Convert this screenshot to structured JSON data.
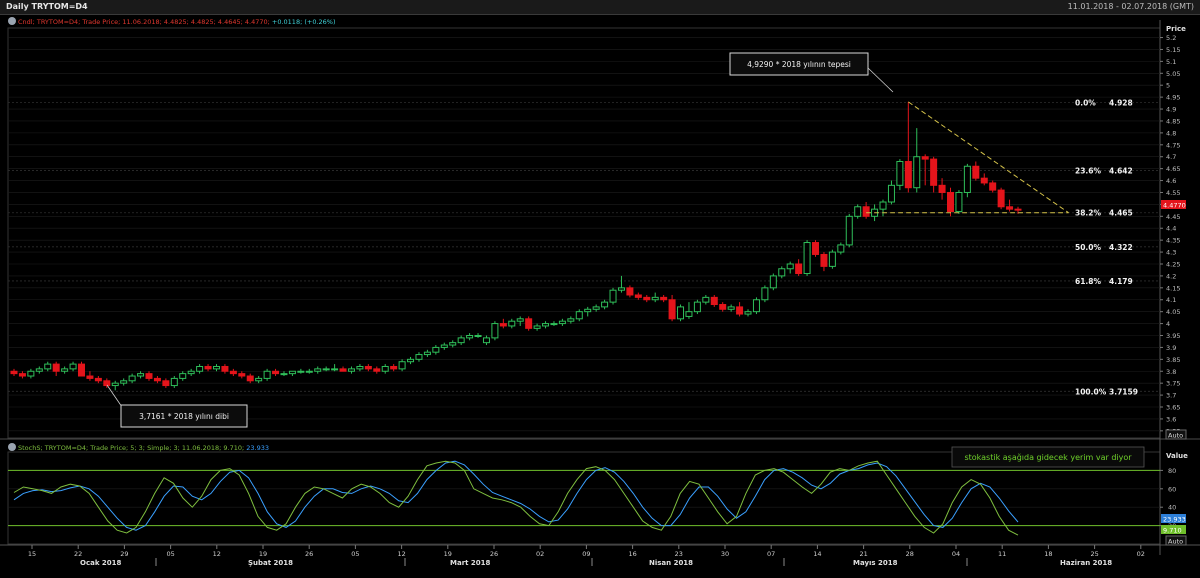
{
  "window": {
    "title": "Daily TRYTOM=D4",
    "date_range": "11.01.2018 - 02.07.2018 (GMT)"
  },
  "price_panel": {
    "legend_series": "Cndl; TRYTOM=D4; Trade Price; 11.06.2018; 4.4825; 4.4825; 4.4645; 4.4770;",
    "legend_change": "+0.0118; (+0.26%)",
    "axis_title": "Price",
    "auto_label": "Auto",
    "last_price_tag": "4.4770",
    "last_price": 4.477,
    "y_ticks": [
      "5.2",
      "5.15",
      "5.1",
      "5.05",
      "5",
      "4.95",
      "4.9",
      "4.85",
      "4.8",
      "4.75",
      "4.7",
      "4.65",
      "4.6",
      "4.55",
      "4.5",
      "4.45",
      "4.4",
      "4.35",
      "4.3",
      "4.25",
      "4.2",
      "4.15",
      "4.1",
      "4.05",
      "4",
      "3.95",
      "3.9",
      "3.85",
      "3.8",
      "3.75",
      "3.7",
      "3.65",
      "3.6",
      "3.55"
    ],
    "ylim": [
      3.52,
      5.24
    ],
    "fibonacci": [
      {
        "level": "0.0%",
        "value": "4.928"
      },
      {
        "level": "23.6%",
        "value": "4.642"
      },
      {
        "level": "38.2%",
        "value": "4.465"
      },
      {
        "level": "50.0%",
        "value": "4.322"
      },
      {
        "level": "61.8%",
        "value": "4.179"
      },
      {
        "level": "100.0%",
        "value": "3.7159"
      }
    ],
    "annotations": {
      "peak": "4,9290 * 2018 yılının tepesi",
      "trough": "3,7161 * 2018 yılını dibi"
    }
  },
  "stoch_panel": {
    "legend_series": "StochS; TRYTOM=D4; Trade Price;  5;  3; Simple;  3;  11.06.2018; 9.710;",
    "legend_value": "23.933",
    "axis_title": "Value",
    "auto_label": "Auto",
    "y_ticks": [
      "80",
      "60",
      "40",
      "20"
    ],
    "ylim": [
      0,
      100
    ],
    "overbought": 80,
    "oversold": 20,
    "tag_blue": "23.933",
    "tag_green": "9.710",
    "comment": "stokastik aşağıda gidecek yerim var diyor"
  },
  "x_axis": {
    "day_ticks": [
      "15",
      "22",
      "29",
      "05",
      "12",
      "19",
      "26",
      "05",
      "12",
      "19",
      "26",
      "02",
      "09",
      "16",
      "23",
      "30",
      "07",
      "14",
      "21",
      "28",
      "04",
      "11",
      "18",
      "25",
      "02"
    ],
    "month_labels": [
      "Ocak 2018",
      "Şubat 2018",
      "Mart 2018",
      "Nisan 2018",
      "Mayıs 2018",
      "Haziran 2018"
    ]
  },
  "colors": {
    "up": "#2fbf5a",
    "down": "#e4141b",
    "stoch_k": "#7fbf3f",
    "stoch_d": "#3aa0ff",
    "band": "#6fbf2a",
    "fib_trend": "#d4c24a"
  },
  "chart_data": {
    "type": "candlestick",
    "series_price": [
      [
        3.8,
        3.81,
        3.78,
        3.79
      ],
      [
        3.79,
        3.8,
        3.77,
        3.78
      ],
      [
        3.78,
        3.81,
        3.77,
        3.8
      ],
      [
        3.8,
        3.82,
        3.79,
        3.81
      ],
      [
        3.81,
        3.84,
        3.8,
        3.83
      ],
      [
        3.83,
        3.84,
        3.78,
        3.8
      ],
      [
        3.8,
        3.82,
        3.79,
        3.81
      ],
      [
        3.81,
        3.84,
        3.8,
        3.83
      ],
      [
        3.83,
        3.84,
        3.78,
        3.78
      ],
      [
        3.78,
        3.8,
        3.76,
        3.77
      ],
      [
        3.77,
        3.78,
        3.75,
        3.76
      ],
      [
        3.76,
        3.77,
        3.73,
        3.74
      ],
      [
        3.74,
        3.76,
        3.72,
        3.75
      ],
      [
        3.75,
        3.77,
        3.74,
        3.76
      ],
      [
        3.76,
        3.79,
        3.75,
        3.78
      ],
      [
        3.78,
        3.8,
        3.77,
        3.79
      ],
      [
        3.79,
        3.8,
        3.76,
        3.77
      ],
      [
        3.77,
        3.78,
        3.75,
        3.76
      ],
      [
        3.76,
        3.77,
        3.73,
        3.74
      ],
      [
        3.74,
        3.78,
        3.73,
        3.77
      ],
      [
        3.77,
        3.8,
        3.76,
        3.79
      ],
      [
        3.79,
        3.81,
        3.78,
        3.8
      ],
      [
        3.8,
        3.83,
        3.79,
        3.82
      ],
      [
        3.82,
        3.83,
        3.8,
        3.81
      ],
      [
        3.81,
        3.83,
        3.8,
        3.82
      ],
      [
        3.82,
        3.83,
        3.79,
        3.8
      ],
      [
        3.8,
        3.81,
        3.78,
        3.79
      ],
      [
        3.79,
        3.8,
        3.77,
        3.78
      ],
      [
        3.78,
        3.79,
        3.75,
        3.76
      ],
      [
        3.76,
        3.78,
        3.75,
        3.77
      ],
      [
        3.77,
        3.81,
        3.76,
        3.8
      ],
      [
        3.8,
        3.81,
        3.78,
        3.79
      ],
      [
        3.79,
        3.8,
        3.78,
        3.79
      ],
      [
        3.79,
        3.8,
        3.78,
        3.8
      ],
      [
        3.8,
        3.81,
        3.79,
        3.8
      ],
      [
        3.8,
        3.81,
        3.79,
        3.8
      ],
      [
        3.8,
        3.82,
        3.79,
        3.81
      ],
      [
        3.81,
        3.82,
        3.8,
        3.81
      ],
      [
        3.81,
        3.83,
        3.8,
        3.81
      ],
      [
        3.81,
        3.82,
        3.8,
        3.8
      ],
      [
        3.8,
        3.82,
        3.79,
        3.81
      ],
      [
        3.81,
        3.83,
        3.8,
        3.82
      ],
      [
        3.82,
        3.83,
        3.8,
        3.81
      ],
      [
        3.81,
        3.82,
        3.79,
        3.8
      ],
      [
        3.8,
        3.83,
        3.79,
        3.82
      ],
      [
        3.82,
        3.83,
        3.8,
        3.81
      ],
      [
        3.81,
        3.85,
        3.8,
        3.84
      ],
      [
        3.84,
        3.86,
        3.83,
        3.85
      ],
      [
        3.85,
        3.88,
        3.84,
        3.87
      ],
      [
        3.87,
        3.89,
        3.86,
        3.88
      ],
      [
        3.88,
        3.91,
        3.87,
        3.9
      ],
      [
        3.9,
        3.92,
        3.89,
        3.91
      ],
      [
        3.91,
        3.93,
        3.9,
        3.92
      ],
      [
        3.92,
        3.95,
        3.91,
        3.94
      ],
      [
        3.94,
        3.96,
        3.93,
        3.95
      ],
      [
        3.95,
        3.96,
        3.94,
        3.95
      ],
      [
        3.92,
        3.95,
        3.91,
        3.94
      ],
      [
        3.94,
        4.01,
        3.93,
        4.0
      ],
      [
        4.0,
        4.02,
        3.98,
        3.99
      ],
      [
        3.99,
        4.02,
        3.98,
        4.01
      ],
      [
        4.01,
        4.03,
        3.99,
        4.02
      ],
      [
        4.02,
        4.03,
        3.97,
        3.98
      ],
      [
        3.98,
        4.0,
        3.97,
        3.99
      ],
      [
        3.99,
        4.01,
        3.98,
        4.0
      ],
      [
        4.0,
        4.01,
        3.99,
        4.0
      ],
      [
        4.0,
        4.02,
        3.99,
        4.01
      ],
      [
        4.01,
        4.03,
        4.0,
        4.02
      ],
      [
        4.02,
        4.06,
        4.01,
        4.05
      ],
      [
        4.05,
        4.07,
        4.03,
        4.06
      ],
      [
        4.06,
        4.08,
        4.05,
        4.07
      ],
      [
        4.07,
        4.1,
        4.06,
        4.09
      ],
      [
        4.09,
        4.15,
        4.08,
        4.14
      ],
      [
        4.14,
        4.2,
        4.13,
        4.15
      ],
      [
        4.15,
        4.16,
        4.11,
        4.12
      ],
      [
        4.12,
        4.13,
        4.1,
        4.11
      ],
      [
        4.11,
        4.12,
        4.09,
        4.1
      ],
      [
        4.1,
        4.13,
        4.09,
        4.11
      ],
      [
        4.11,
        4.12,
        4.09,
        4.1
      ],
      [
        4.1,
        4.12,
        4.01,
        4.02
      ],
      [
        4.02,
        4.08,
        4.01,
        4.07
      ],
      [
        4.03,
        4.09,
        4.02,
        4.05
      ],
      [
        4.05,
        4.1,
        4.04,
        4.09
      ],
      [
        4.09,
        4.12,
        4.08,
        4.11
      ],
      [
        4.11,
        4.12,
        4.07,
        4.08
      ],
      [
        4.08,
        4.09,
        4.05,
        4.06
      ],
      [
        4.06,
        4.08,
        4.05,
        4.07
      ],
      [
        4.07,
        4.09,
        4.03,
        4.04
      ],
      [
        4.04,
        4.06,
        4.03,
        4.05
      ],
      [
        4.05,
        4.11,
        4.04,
        4.1
      ],
      [
        4.1,
        4.16,
        4.09,
        4.15
      ],
      [
        4.15,
        4.21,
        4.14,
        4.2
      ],
      [
        4.2,
        4.24,
        4.19,
        4.23
      ],
      [
        4.23,
        4.26,
        4.21,
        4.25
      ],
      [
        4.25,
        4.27,
        4.2,
        4.21
      ],
      [
        4.21,
        4.35,
        4.2,
        4.34
      ],
      [
        4.34,
        4.35,
        4.28,
        4.29
      ],
      [
        4.29,
        4.3,
        4.22,
        4.24
      ],
      [
        4.24,
        4.31,
        4.23,
        4.3
      ],
      [
        4.3,
        4.34,
        4.29,
        4.33
      ],
      [
        4.33,
        4.46,
        4.32,
        4.45
      ],
      [
        4.45,
        4.5,
        4.44,
        4.49
      ],
      [
        4.49,
        4.51,
        4.44,
        4.45
      ],
      [
        4.45,
        4.5,
        4.43,
        4.48
      ],
      [
        4.48,
        4.52,
        4.45,
        4.51
      ],
      [
        4.51,
        4.6,
        4.5,
        4.58
      ],
      [
        4.58,
        4.69,
        4.56,
        4.68
      ],
      [
        4.68,
        4.93,
        4.55,
        4.57
      ],
      [
        4.57,
        4.82,
        4.55,
        4.7
      ],
      [
        4.7,
        4.71,
        4.58,
        4.69
      ],
      [
        4.69,
        4.7,
        4.55,
        4.58
      ],
      [
        4.58,
        4.61,
        4.52,
        4.55
      ],
      [
        4.55,
        4.57,
        4.45,
        4.47
      ],
      [
        4.47,
        4.56,
        4.46,
        4.55
      ],
      [
        4.55,
        4.67,
        4.53,
        4.66
      ],
      [
        4.66,
        4.68,
        4.6,
        4.61
      ],
      [
        4.61,
        4.63,
        4.58,
        4.59
      ],
      [
        4.59,
        4.6,
        4.55,
        4.56
      ],
      [
        4.56,
        4.57,
        4.48,
        4.49
      ],
      [
        4.49,
        4.52,
        4.47,
        4.48
      ],
      [
        4.48,
        4.49,
        4.46,
        4.477
      ]
    ],
    "stoch_k": [
      56,
      62,
      60,
      58,
      55,
      62,
      65,
      63,
      55,
      40,
      25,
      15,
      12,
      18,
      35,
      55,
      72,
      66,
      50,
      40,
      52,
      70,
      80,
      82,
      75,
      55,
      30,
      18,
      15,
      22,
      40,
      55,
      62,
      60,
      55,
      50,
      60,
      65,
      62,
      55,
      45,
      40,
      52,
      70,
      85,
      88,
      90,
      88,
      80,
      60,
      55,
      50,
      48,
      45,
      40,
      30,
      22,
      20,
      35,
      55,
      70,
      82,
      84,
      80,
      70,
      55,
      40,
      25,
      18,
      15,
      30,
      55,
      68,
      65,
      50,
      35,
      22,
      30,
      55,
      75,
      80,
      82,
      78,
      70,
      62,
      55,
      65,
      78,
      82,
      80,
      85,
      88,
      90,
      75,
      60,
      45,
      30,
      18,
      12,
      22,
      45,
      62,
      70,
      65,
      50,
      30,
      15,
      9.71
    ],
    "stoch_d": [
      48,
      55,
      58,
      59,
      57,
      58,
      61,
      63,
      60,
      52,
      40,
      28,
      18,
      15,
      20,
      35,
      52,
      63,
      62,
      52,
      48,
      55,
      68,
      78,
      80,
      72,
      55,
      35,
      22,
      18,
      25,
      40,
      52,
      60,
      60,
      56,
      55,
      60,
      63,
      60,
      55,
      47,
      45,
      55,
      70,
      80,
      88,
      90,
      86,
      76,
      65,
      56,
      52,
      48,
      44,
      38,
      30,
      24,
      26,
      38,
      55,
      70,
      80,
      83,
      78,
      68,
      55,
      40,
      28,
      20,
      20,
      32,
      50,
      62,
      62,
      52,
      38,
      28,
      35,
      52,
      70,
      80,
      82,
      78,
      72,
      64,
      60,
      66,
      76,
      80,
      82,
      86,
      88,
      84,
      74,
      60,
      46,
      32,
      20,
      18,
      28,
      45,
      60,
      66,
      62,
      50,
      36,
      23.933
    ]
  }
}
